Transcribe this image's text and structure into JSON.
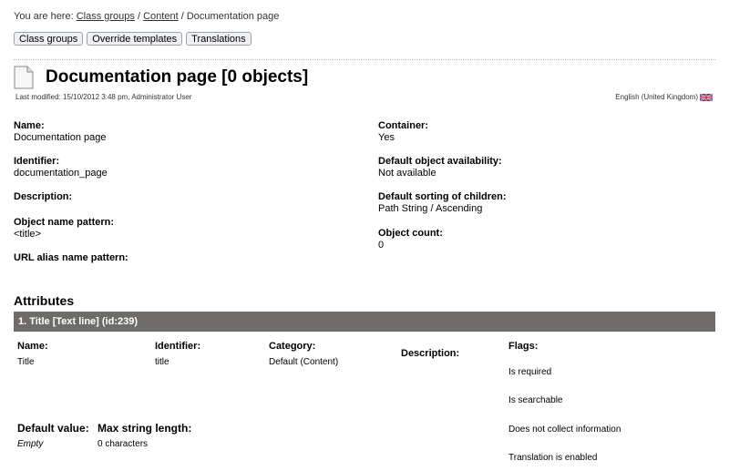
{
  "breadcrumb": {
    "prefix": "You are here:",
    "items": [
      "Class groups",
      "Content"
    ],
    "current": "Documentation page",
    "sep": "/"
  },
  "tabs": [
    "Class groups",
    "Override templates",
    "Translations"
  ],
  "header": {
    "title": "Documentation page [0 objects]",
    "modified": "Last modified: 15/10/2012 3:48 pm, Administrator User",
    "language": "English (United Kingdom)"
  },
  "info": {
    "name_label": "Name:",
    "name": "Documentation page",
    "identifier_label": "Identifier:",
    "identifier": "documentation_page",
    "description_label": "Description:",
    "pattern_label": "Object name pattern:",
    "pattern": "<title>",
    "url_label": "URL alias name pattern:",
    "container_label": "Container:",
    "container": "Yes",
    "availability_label": "Default object availability:",
    "availability": "Not available",
    "sorting_label": "Default sorting of children:",
    "sorting": "Path String / Ascending",
    "count_label": "Object count:",
    "count": "0"
  },
  "attributes": {
    "heading": "Attributes",
    "items": [
      {
        "bar": "1. Title [Text line] (id:239)",
        "name_label": "Name:",
        "name": "Title",
        "identifier_label": "Identifier:",
        "identifier": "title",
        "category_label": "Category:",
        "category": "Default (Content)",
        "description_label": "Description:",
        "flags_label": "Flags:",
        "flags": [
          "Is required",
          "Is searchable",
          "Does not collect information",
          "Translation is enabled"
        ],
        "default_label": "Default value:",
        "default": "Empty",
        "maxlen_label": "Max string length:",
        "maxlen": "0 characters"
      }
    ]
  },
  "colors": {
    "attr_bar": "#6e6c69"
  },
  "icons": {
    "document": "document-icon",
    "flag": "uk-flag-icon"
  }
}
